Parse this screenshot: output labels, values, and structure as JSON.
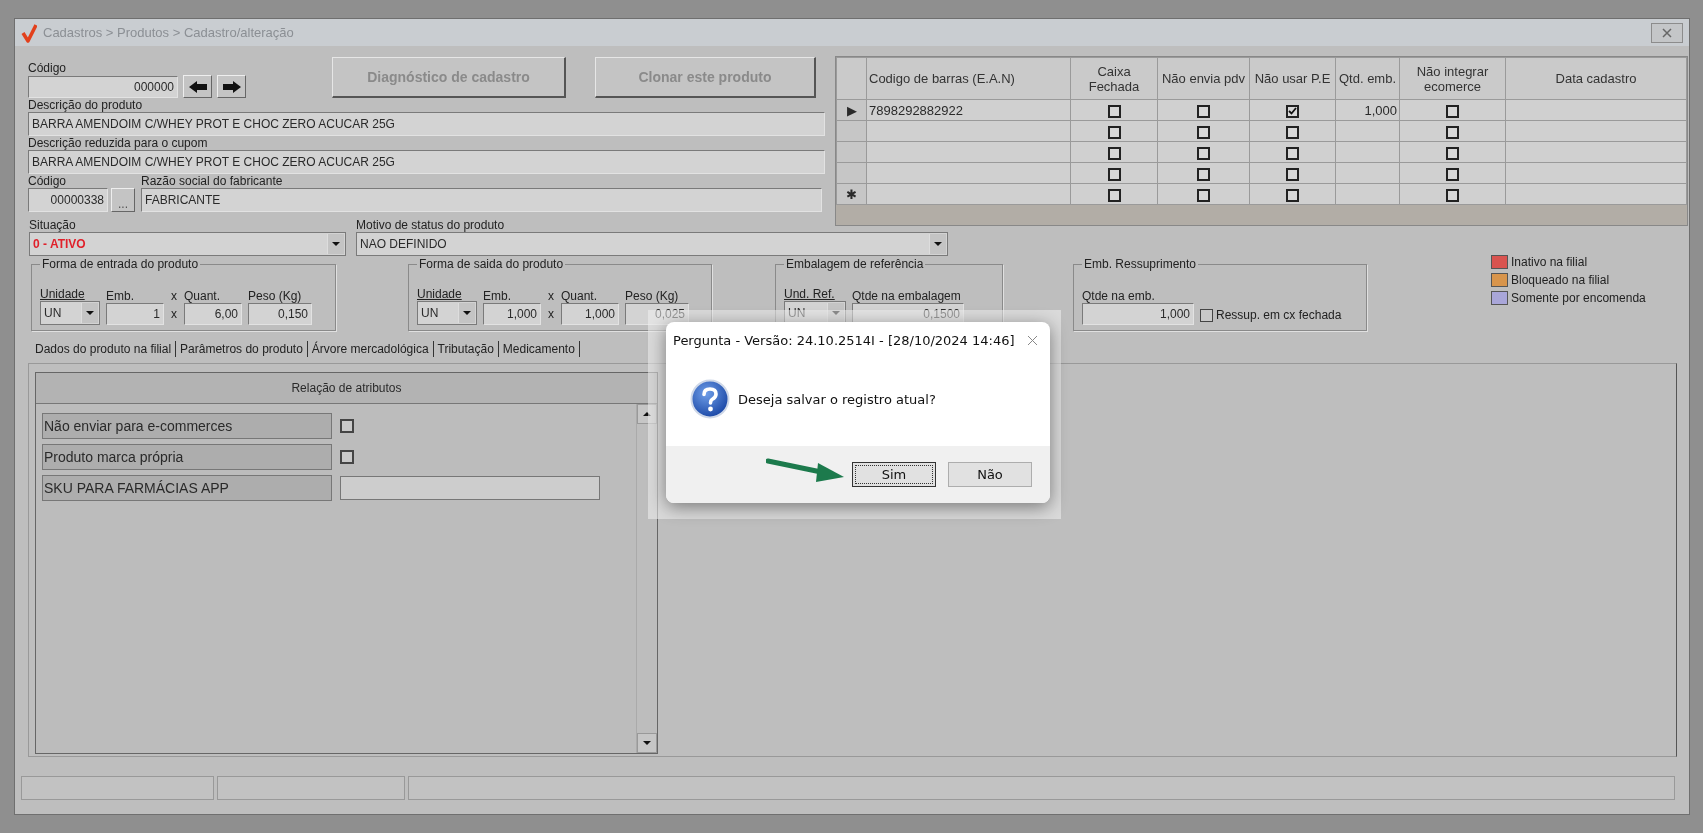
{
  "window": {
    "title": "Cadastros > Produtos > Cadastro/alteração"
  },
  "product": {
    "code_label": "Código",
    "code": "000000",
    "diagnostic_button": "Diagnóstico de cadastro",
    "clone_button": "Clonar este produto",
    "description_label": "Descrição  do produto",
    "description": "BARRA AMENDOIM C/WHEY PROT E CHOC ZERO ACUCAR 25G",
    "short_description_label": "Descrição reduzida para o cupom",
    "short_description": "BARRA AMENDOIM C/WHEY PROT E CHOC ZERO ACUCAR 25G",
    "maker_code_label": "Código",
    "maker_code": "00000338",
    "maker_browse_button": "...",
    "maker_name_label": "Razão social do fabricante",
    "maker_name": "FABRICANTE",
    "status_label": "Situação",
    "status": "0 - ATIVO",
    "reason_label": "Motivo de status do produto",
    "reason": "NAO DEFINIDO"
  },
  "barcodes": {
    "columns": [
      "Codigo de barras (E.A.N)",
      "Caixa Fechada",
      "Não envia pdv",
      "Não usar P.E",
      "Qtd. emb.",
      "Não integrar ecomerce",
      "Data cadastro"
    ],
    "rows": [
      {
        "marker": "▶",
        "ean": "7898292882922",
        "caixa_fechada": false,
        "nao_envia_pdv": false,
        "nao_usar_pe": true,
        "qtd_emb": "1,000",
        "nao_integrar_ecomerce": false
      },
      {
        "caixa_fechada": false,
        "nao_envia_pdv": false,
        "nao_usar_pe": false,
        "nao_integrar_ecomerce": false
      },
      {
        "caixa_fechada": false,
        "nao_envia_pdv": false,
        "nao_usar_pe": false,
        "nao_integrar_ecomerce": false
      },
      {
        "caixa_fechada": false,
        "nao_envia_pdv": false,
        "nao_usar_pe": false,
        "nao_integrar_ecomerce": false
      },
      {
        "marker": "✱",
        "caixa_fechada": false,
        "nao_envia_pdv": false,
        "nao_usar_pe": false,
        "nao_integrar_ecomerce": false
      }
    ]
  },
  "entry": {
    "title": "Forma de entrada do produto",
    "unit_label": "Unidade",
    "unit": "UN",
    "emb_label": "Emb.",
    "emb": "1",
    "times_label": "x",
    "quant_label": "Quant.",
    "times": "x",
    "quant": "6,00",
    "weight_label": "Peso (Kg)",
    "weight": "0,150"
  },
  "exit": {
    "title": "Forma de saida do produto",
    "unit_label": "Unidade",
    "unit": "UN",
    "emb_label": "Emb.",
    "emb": "1,000",
    "times_label": "x",
    "quant_label": "Quant.",
    "times": "x",
    "quant": "1,000",
    "weight_label": "Peso (Kg)",
    "weight": "0,025"
  },
  "reference_package": {
    "title": "Embalagem de referência",
    "unit_label": "Und. Ref.",
    "unit": "UN",
    "qty_label": "Qtde na embalagem",
    "qty": "0,1500"
  },
  "resupply": {
    "title": "Emb. Ressuprimento",
    "qty_label": "Qtde na emb.",
    "qty": "1,000",
    "closed_box_label": "Ressup. em cx fechada",
    "closed_box": false
  },
  "legend": [
    {
      "label": "Inativo na filial",
      "color": "#d9534f"
    },
    {
      "label": "Bloqueado na filial",
      "color": "#d8954c"
    },
    {
      "label": "Somente por encomenda",
      "color": "#a9a6d9"
    }
  ],
  "tabs": [
    {
      "label": "Dados do produto na filial"
    },
    {
      "label": "Parâmetros do produto"
    },
    {
      "label": "Árvore mercadológica"
    },
    {
      "label": "Tributação"
    },
    {
      "label": "Medicamento"
    }
  ],
  "attributes": {
    "title": "Relação de atributos",
    "items": [
      {
        "kind": "check",
        "label": "Não enviar para e-commerces",
        "checked": false
      },
      {
        "kind": "check",
        "label": "Produto marca própria",
        "checked": false
      },
      {
        "kind": "text",
        "label": "SKU PARA FARMÁCIAS APP"
      }
    ]
  },
  "dialog": {
    "title": "Pergunta - Versão: 24.10.2514I - [28/10/2024 14:46]",
    "message": "Deseja salvar o registro atual?",
    "buttons": [
      {
        "label": "Sim",
        "selected": true
      },
      {
        "label": "Não",
        "selected": false
      }
    ]
  }
}
